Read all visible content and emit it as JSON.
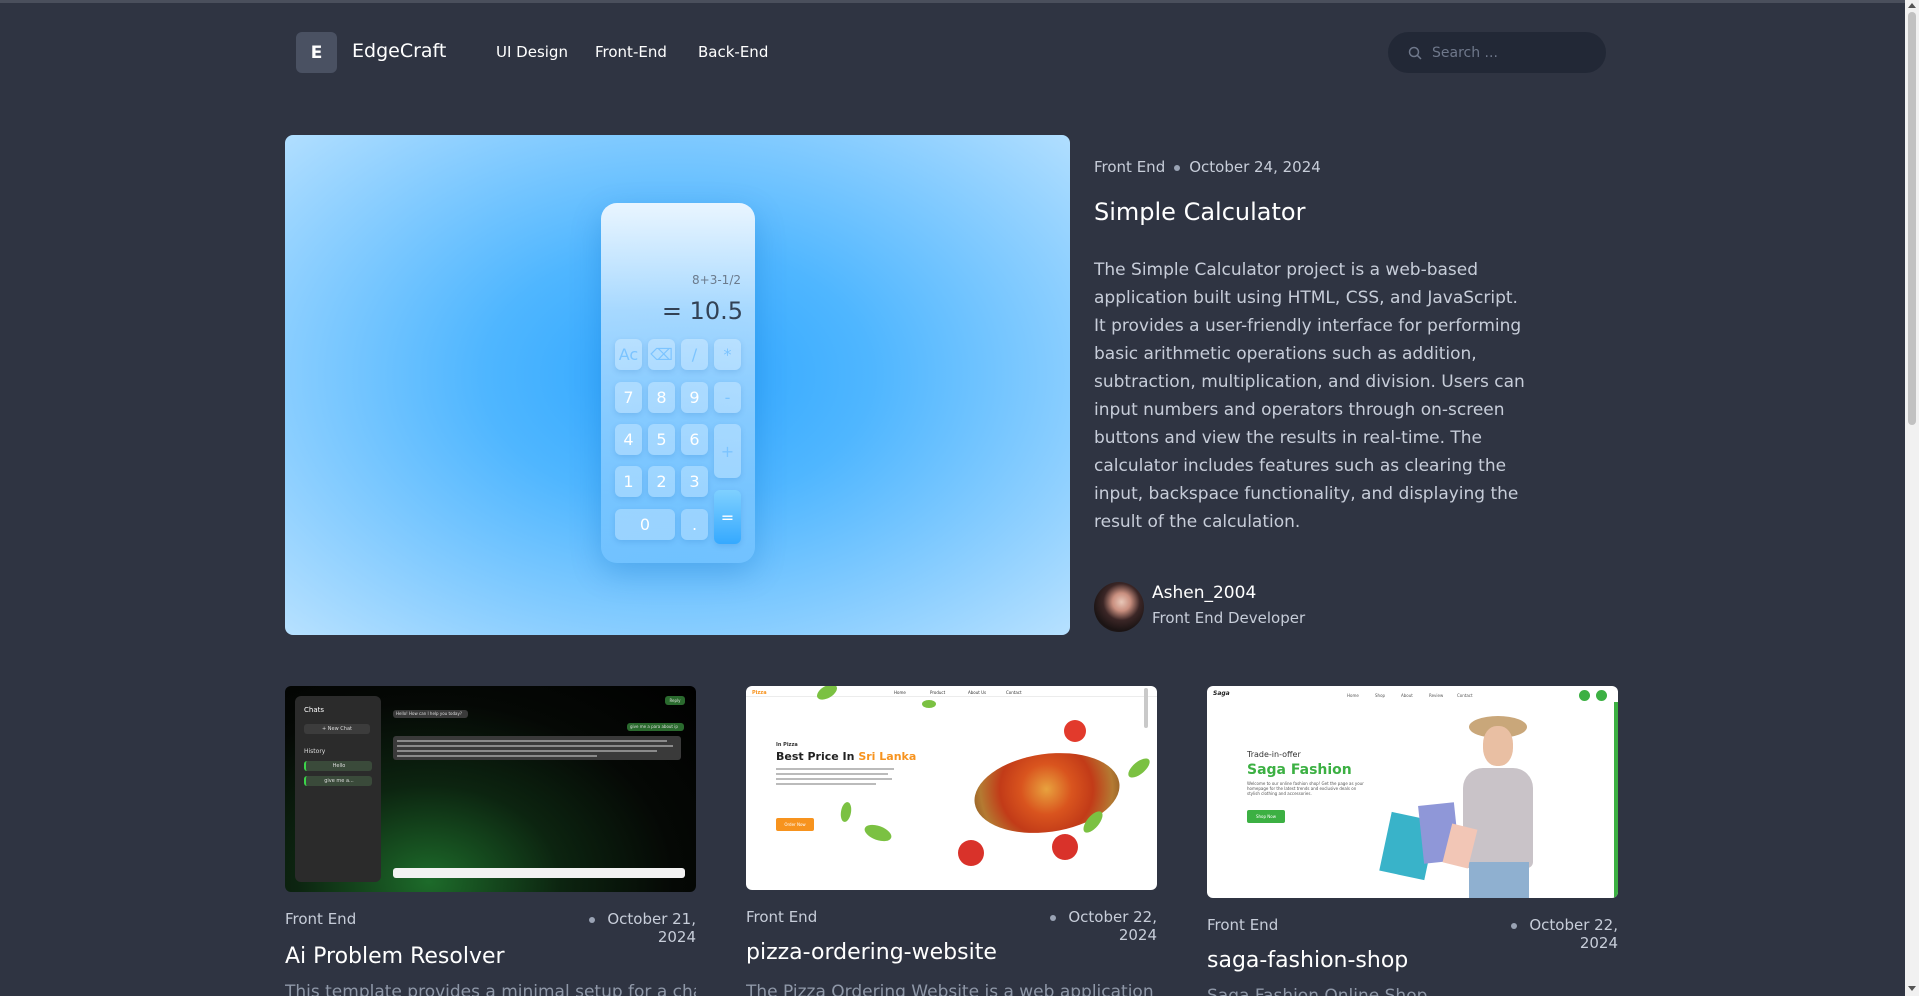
{
  "header": {
    "logo_letter": "E",
    "brand": "EdgeCraft",
    "nav": [
      "UI Design",
      "Front-End",
      "Back-End"
    ],
    "search_placeholder": "Search ..."
  },
  "hero": {
    "calculator": {
      "expression": "8+3-1/2",
      "result": "= 10.5",
      "keys": [
        "Ac",
        "⌫",
        "/",
        "*",
        "7",
        "8",
        "9",
        "-",
        "4",
        "5",
        "6",
        "+",
        "1",
        "2",
        "3",
        "=",
        "0",
        "."
      ]
    },
    "category": "Front End",
    "date": "October 24, 2024",
    "title": "Simple Calculator",
    "description": "The Simple Calculator project is a web-based application built using HTML, CSS, and JavaScript. It provides a user-friendly interface for performing basic arithmetic operations such as addition, subtraction, multiplication, and division. Users can input numbers and operators through on-screen buttons and view the results in real-time. The calculator includes features such as clearing the input, backspace functionality, and displaying the result of the calculation.",
    "author_name": "Ashen_2004",
    "author_role": "Front End Developer"
  },
  "cards": [
    {
      "category": "Front End",
      "date": "October 21, 2024",
      "title": "Ai Problem Resolver",
      "description_partial": "This template provides a minimal setup for a chat",
      "thumb": {
        "sidebar_title": "Chats",
        "new_chat": "+ New Chat",
        "history_label": "History",
        "history_items": [
          "Hello",
          "give me a..."
        ],
        "bubble1": "Hello! How can I help you today?",
        "bubble2": "give me a para about ip",
        "button": "Reply"
      }
    },
    {
      "category": "Front End",
      "date": "October 22, 2024",
      "title": "pizza-ordering-website",
      "description_partial": "The Pizza Ordering Website is a web application",
      "thumb": {
        "logo": "Pizza",
        "nav": [
          "Home",
          "Product",
          "About Us",
          "Contact"
        ],
        "kicker": "In Pizza",
        "headline_a": "Best Price In ",
        "headline_b": "Sri Lanka",
        "button": "Order Now"
      }
    },
    {
      "category": "Front End",
      "date": "October 22, 2024",
      "title": "saga-fashion-shop",
      "description_partial": "Saga Fashion Online Shop",
      "thumb": {
        "logo": "Saga",
        "nav": [
          "Home",
          "Shop",
          "About",
          "Review",
          "Contact"
        ],
        "kicker": "Trade-in-offer",
        "headline": "Saga Fashion",
        "subtext": "Welcome to our online fashion shop! Get the page as your homepage for the latest trends and exclusive deals on stylish clothing and accessories.",
        "button": "Shop Now"
      }
    }
  ],
  "colors": {
    "background": "#2f3442",
    "accent_blue": "#2ea6ff",
    "pizza_orange": "#f7931e",
    "saga_green": "#3cb043"
  }
}
